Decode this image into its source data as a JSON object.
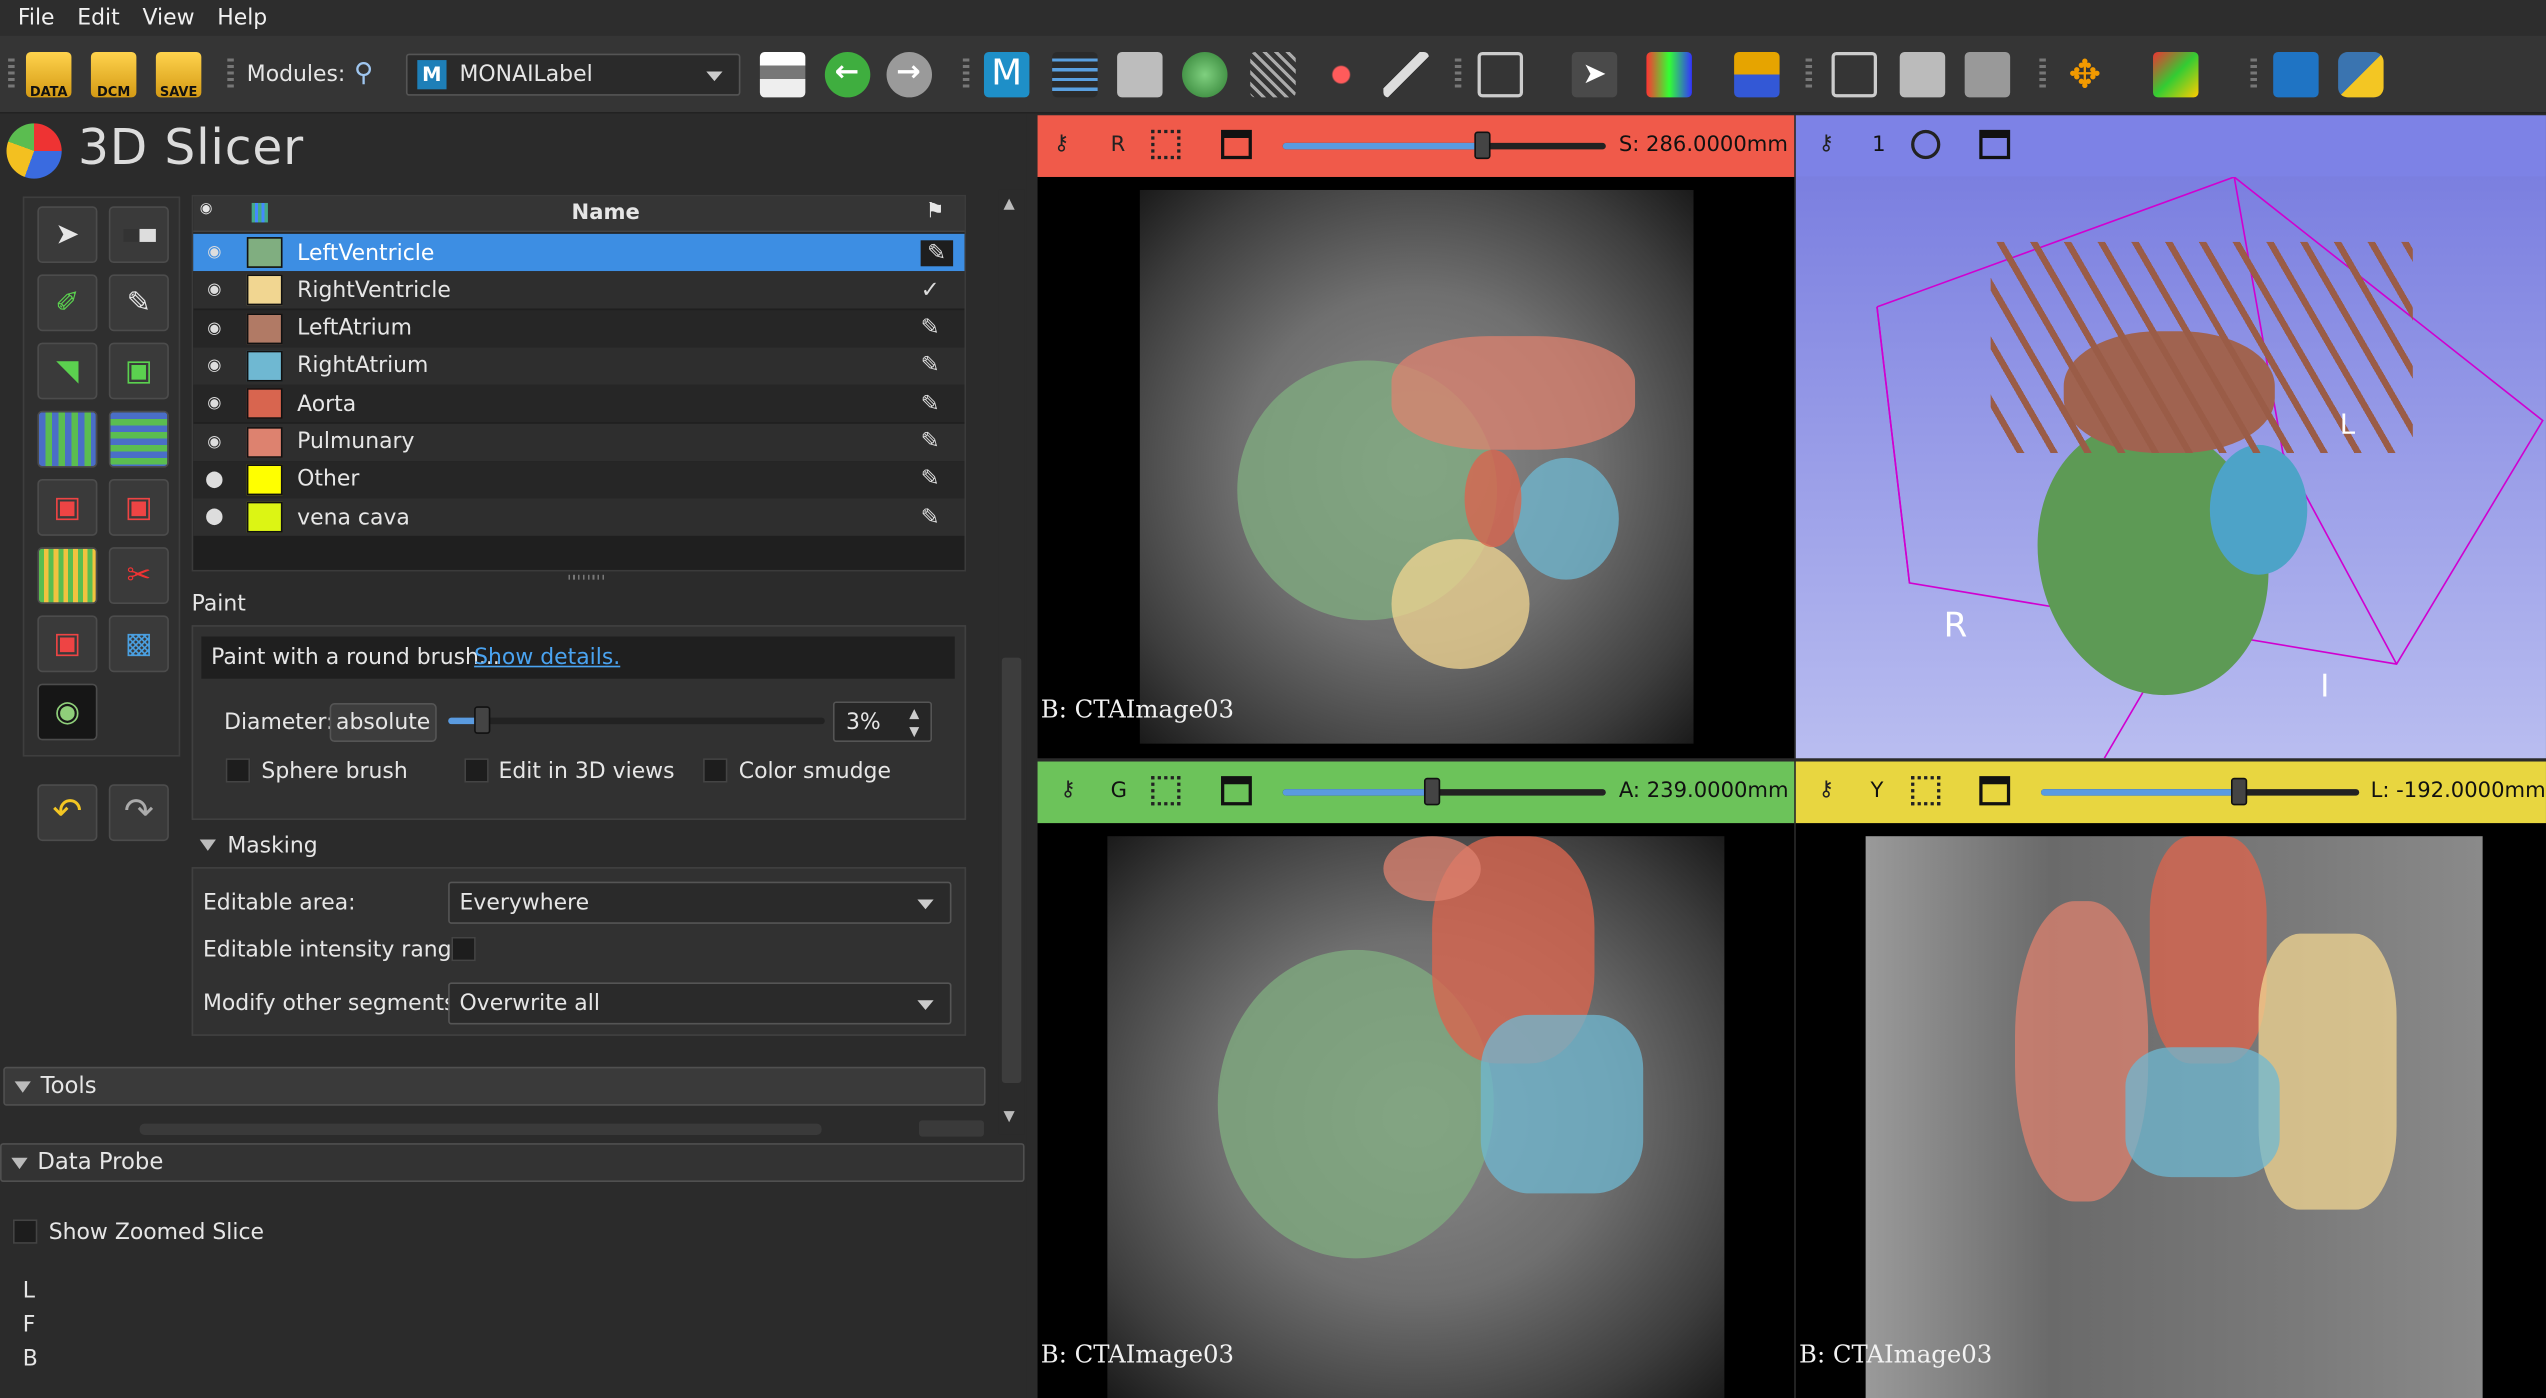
{
  "menu": [
    "File",
    "Edit",
    "View",
    "Help"
  ],
  "toolbar": {
    "data_label": "DATA",
    "dcm_label": "DCM",
    "save_label": "SAVE",
    "modules_label": "Modules:",
    "module_selected": "MONAILabel"
  },
  "app_title": "3D Slicer",
  "segments": {
    "header_name": "Name",
    "items": [
      {
        "name": "LeftVentricle",
        "color": "#80ae80"
      },
      {
        "name": "RightVentricle",
        "color": "#f1d691"
      },
      {
        "name": "LeftAtrium",
        "color": "#b17a65"
      },
      {
        "name": "RightAtrium",
        "color": "#6fb8d2"
      },
      {
        "name": "Aorta",
        "color": "#d8654f"
      },
      {
        "name": "Pulmunary",
        "color": "#dd826f"
      },
      {
        "name": "Other",
        "color": "#ffff00"
      },
      {
        "name": "vena cava",
        "color": "#dcf514"
      }
    ]
  },
  "paint": {
    "title": "Paint",
    "info": "Paint with a round brush...",
    "details_link": "Show details.",
    "diameter_label": "Diameter:",
    "diameter_mode": "absolute",
    "diameter_value": "3%",
    "sphere_brush": "Sphere brush",
    "edit_3d": "Edit in 3D views",
    "color_smudge": "Color smudge"
  },
  "masking": {
    "title": "Masking",
    "editable_area_label": "Editable area:",
    "editable_area_value": "Everywhere",
    "intensity_label": "Editable intensity range:",
    "modify_label": "Modify other segments:",
    "modify_value": "Overwrite all"
  },
  "tools_label": "Tools",
  "data_probe": {
    "title": "Data Probe",
    "show_zoomed": "Show Zoomed Slice",
    "coords": [
      "L",
      "F",
      "B"
    ]
  },
  "views": {
    "red": {
      "letter": "R",
      "offset": "S: 286.0000mm",
      "volume": "B: CTAImage03",
      "color": "#f05a4a"
    },
    "three_d": {
      "letter": "1",
      "color": "#7d82e6",
      "labels": {
        "L": "L",
        "R": "R",
        "I": "I"
      }
    },
    "green": {
      "letter": "G",
      "offset": "A: 239.0000mm",
      "volume": "B: CTAImage03",
      "color": "#6cc35a"
    },
    "yellow": {
      "letter": "Y",
      "offset": "L: -192.0000mm",
      "volume": "B: CTAImage03",
      "color": "#e8d640"
    }
  },
  "slider_levels": {
    "red": 0.62,
    "green": 0.46,
    "yellow": 0.62,
    "diameter": 0.09
  }
}
